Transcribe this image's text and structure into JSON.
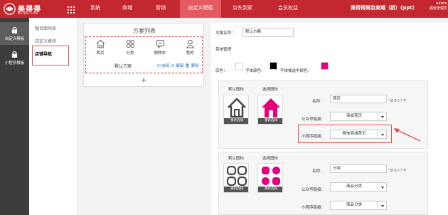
{
  "brand": {
    "name": "美得得",
    "sub": "MEIDD.COM"
  },
  "topnav": [
    "系统",
    "商城",
    "营销",
    "自定义模板",
    "京东到家",
    "会员权益"
  ],
  "store_title": "美得得美妆商城（新）(ppt)",
  "user": {
    "line1": "admin",
    "line2": "超级管理员"
  },
  "sidebar": [
    "自定义模板",
    "小程序模板"
  ],
  "subnav": [
    "微页面场景",
    "自定义模块",
    "店铺导航"
  ],
  "plan": {
    "title": "方案列表",
    "icons": [
      {
        "label": "首页",
        "icon": "home-icon"
      },
      {
        "label": "分类",
        "icon": "category-icon"
      },
      {
        "label": "购物车",
        "icon": "cart-icon"
      },
      {
        "label": "我的",
        "icon": "user-icon"
      }
    ],
    "name": "默认方案",
    "actions": "☑ 启用 ☑ 编辑 🗑 删除",
    "add": "+"
  },
  "form": {
    "plan_name_label": "方案名称：",
    "plan_name_value": "默认方案",
    "section": "菜单管理",
    "bg_label": "底色：",
    "font_label": "字体颜色：",
    "font_sel_label": "字体被选中颜色：",
    "colors": {
      "bg": "#ffffff",
      "font": "#000000",
      "font_selected": "#e6007e"
    }
  },
  "items": [
    {
      "default_cap": "默认图标",
      "selected_cap": "选择图标",
      "reselect": "重新选择",
      "name_label": "名称：",
      "name_value": "首页",
      "hint": "*最多3个字",
      "gzh_label": "公众号链接：",
      "gzh_value": "商城首页",
      "mp_label": "小程序链接：",
      "mp_value": "微信商城首页"
    },
    {
      "default_cap": "默认图标",
      "selected_cap": "选择图标",
      "reselect": "重新选择",
      "name_label": "名称：",
      "name_value": "分类",
      "hint": "*最多3个字",
      "gzh_label": "公众号链接：",
      "gzh_value": "商品分类",
      "mp_label": "小程序链接：",
      "mp_value": "商品分类"
    }
  ],
  "accent": "#c4282f"
}
